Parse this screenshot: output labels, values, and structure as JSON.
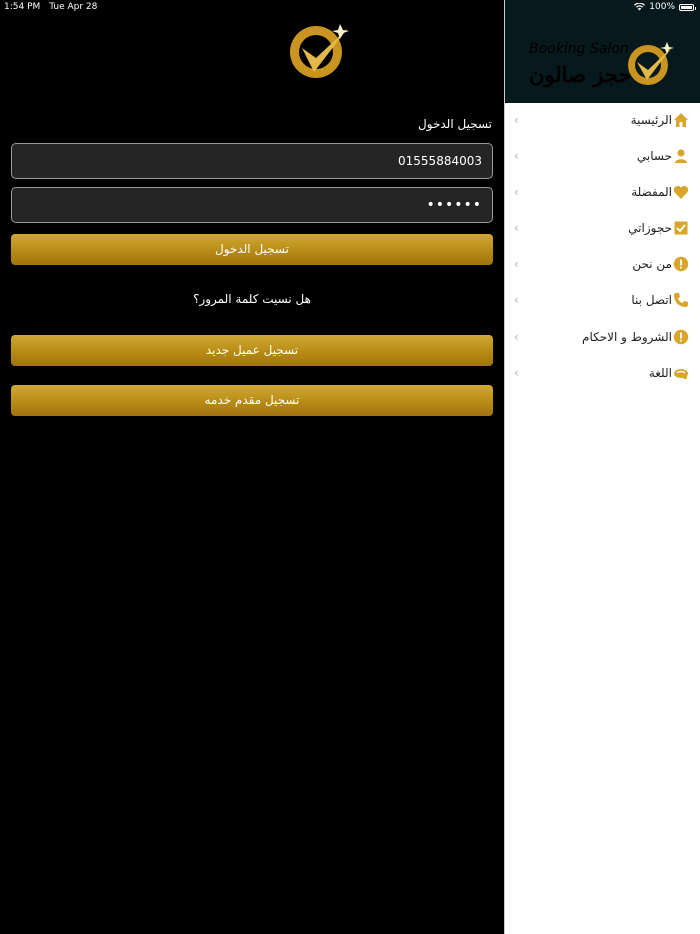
{
  "status": {
    "time": "1:54 PM",
    "date": "Tue Apr 28",
    "battery": "100%",
    "battery_level": 1.0
  },
  "logo": {
    "en": "Booking Salon",
    "ar": "حجز صالون"
  },
  "login": {
    "title": "تسجيل الدخول",
    "phone_value": "01555884003",
    "password_value": "••••••",
    "login_button": "تسجيل الدخول",
    "forgot": "هل نسيت كلمة المرور؟",
    "new_client_button": "تسجيل عميل جديد",
    "provider_button": "تسجيل مقدم خدمه"
  },
  "menu": {
    "items": [
      {
        "label": "الرئيسية",
        "icon": "home-icon"
      },
      {
        "label": "حسابي",
        "icon": "person-icon"
      },
      {
        "label": "المفضلة",
        "icon": "heart-icon"
      },
      {
        "label": "حجوزاتي",
        "icon": "checkbox-icon"
      },
      {
        "label": "من نحن",
        "icon": "info-icon"
      },
      {
        "label": "اتصل بنا",
        "icon": "phone-icon"
      },
      {
        "label": "الشروط و الاحكام",
        "icon": "info-icon"
      },
      {
        "label": "اللغة",
        "icon": "language-icon"
      }
    ]
  },
  "colors": {
    "gold": "#d9a62c",
    "drawer_header": "#07191d",
    "field_bg": "#252525"
  }
}
